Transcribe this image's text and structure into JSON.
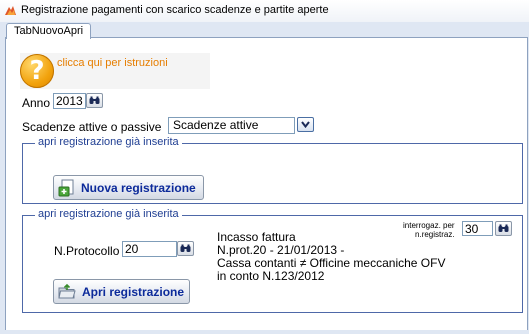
{
  "window": {
    "title": "Registrazione pagamenti con scarico scadenze e partite aperte",
    "icon": "app-logo-icon"
  },
  "tabs": [
    {
      "label": "TabNuovoApri",
      "selected": true
    }
  ],
  "help": {
    "icon": "question-icon",
    "link_text": "clicca qui per istruzioni"
  },
  "anno": {
    "label": "Anno",
    "value": "2013",
    "search_icon": "binoculars-icon"
  },
  "scadenze": {
    "label": "Scadenze attive o passive",
    "selected": "Scadenze attive",
    "dropdown_icon": "chevron-down-icon"
  },
  "group_new": {
    "legend": "apri registrazione già inserita",
    "button_label": "Nuova registrazione",
    "button_icon": "new-document-icon"
  },
  "group_open": {
    "legend": "apri registrazione già inserita",
    "protocollo_label": "N.Protocollo",
    "protocollo_value": "20",
    "search_icon": "binoculars-icon",
    "interrogaz_label_1": "interrogaz. per",
    "interrogaz_label_2": "n.registraz.",
    "interrogaz_value": "30",
    "info_lines": [
      "Incasso fattura",
      "N.prot.20 - 21/01/2013 -",
      "Cassa contanti ≠ Officine meccaniche OFV",
      "in conto N.123/2012"
    ],
    "button_label": "Apri registrazione",
    "button_icon": "open-folder-icon"
  },
  "colors": {
    "link_orange": "#e67e00",
    "legend_blue": "#1f3e92",
    "button_text_blue": "#0c2a9a",
    "group_border": "#4e68a8"
  }
}
